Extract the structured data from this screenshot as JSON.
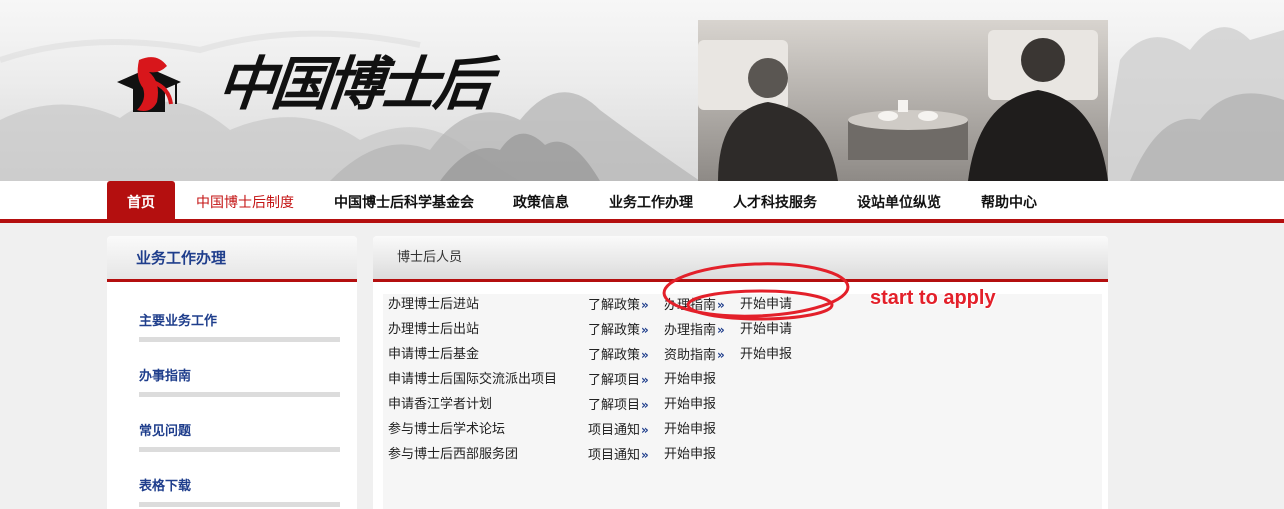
{
  "site": {
    "title": "中国博士后"
  },
  "nav": {
    "items": [
      {
        "label": "首页"
      },
      {
        "label": "中国博士后制度"
      },
      {
        "label": "中国博士后科学基金会"
      },
      {
        "label": "政策信息"
      },
      {
        "label": "业务工作办理"
      },
      {
        "label": "人才科技服务"
      },
      {
        "label": "设站单位纵览"
      },
      {
        "label": "帮助中心"
      }
    ]
  },
  "sidebar": {
    "title": "业务工作办理",
    "links": [
      "主要业务工作",
      "办事指南",
      "常见问题",
      "表格下载"
    ]
  },
  "main": {
    "section_title": "博士后人员",
    "rows": [
      {
        "name": "办理博士后进站",
        "a": "了解政策",
        "b": "办理指南",
        "c": "开始申请"
      },
      {
        "name": "办理博士后出站",
        "a": "了解政策",
        "b": "办理指南",
        "c": "开始申请"
      },
      {
        "name": "申请博士后基金",
        "a": "了解政策",
        "b": "资助指南",
        "c": "开始申报"
      },
      {
        "name": "申请博士后国际交流派出项目",
        "a": "了解项目",
        "b": "开始申报",
        "c": ""
      },
      {
        "name": "申请香江学者计划",
        "a": "了解项目",
        "b": "开始申报",
        "c": ""
      },
      {
        "name": "参与博士后学术论坛",
        "a": "项目通知",
        "b": "开始申报",
        "c": ""
      },
      {
        "name": "参与博士后西部服务团",
        "a": "项目通知",
        "b": "开始申报",
        "c": ""
      }
    ]
  },
  "annotation": {
    "text": "start to apply",
    "color": "#e3202a"
  },
  "colors": {
    "brand_red": "#b40f0f",
    "link_blue": "#1f3e8c"
  },
  "icons": {
    "arrow": "»"
  }
}
